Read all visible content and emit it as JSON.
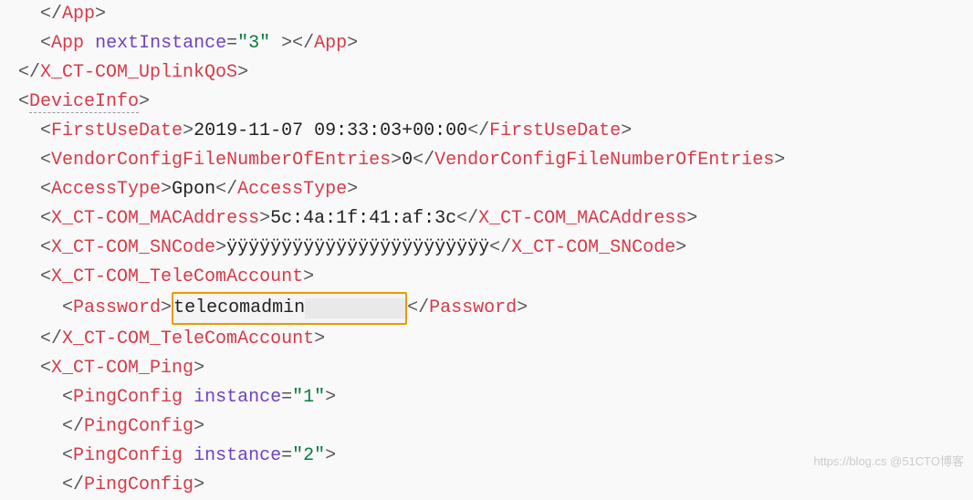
{
  "lines": {
    "l1_close_app": "App",
    "l2_open_app": "App",
    "l2_attr": "nextInstance",
    "l2_val": "\"3\"",
    "l2_close_app": "App",
    "l3_close": "X_CT-COM_UplinkQoS",
    "l4_open": "DeviceInfo",
    "l5_tag": "FirstUseDate",
    "l5_text": "2019-11-07 09:33:03+00:00",
    "l6_tag": "VendorConfigFileNumberOfEntries",
    "l6_text": "0",
    "l7_tag": "AccessType",
    "l7_text": "Gpon",
    "l8_tag": "X_CT-COM_MACAddress",
    "l8_text": "5c:4a:1f:41:af:3c",
    "l9_tag": "X_CT-COM_SNCode",
    "l9_text": "ÿÿÿÿÿÿÿÿÿÿÿÿÿÿÿÿÿÿÿÿÿÿÿÿ",
    "l10_tag": "X_CT-COM_TeleComAccount",
    "l11_tag": "Password",
    "l11_text": "telecomadmin",
    "l12_tag": "X_CT-COM_TeleComAccount",
    "l13_tag": "X_CT-COM_Ping",
    "l14_tag": "PingConfig",
    "l14_attr": "instance",
    "l14_val": "\"1\"",
    "l15_tag": "PingConfig",
    "l16_tag": "PingConfig",
    "l16_attr": "instance",
    "l16_val": "\"2\"",
    "l17_tag": "PingConfig"
  },
  "watermark": "https://blog.cs     @51CTO博客"
}
